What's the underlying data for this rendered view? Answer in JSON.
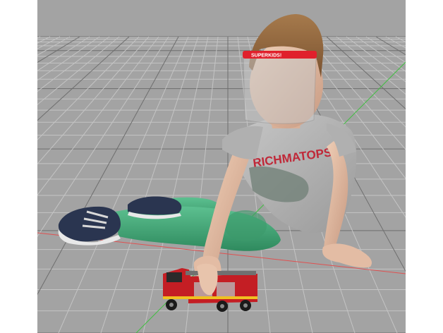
{
  "scene": {
    "background_color": "#a3a3a3",
    "grid_color": "#c4c4c4",
    "grid_major_color": "#6e6e6e",
    "x_axis_color": "#e05050",
    "z_axis_color": "#3fbf3f"
  },
  "face_shield": {
    "band_text": "SUPERKIDS!",
    "band_color": "#e0202c"
  },
  "shirt": {
    "print_text": "RICHMATOPS",
    "print_color": "#c02838",
    "fabric_color": "#b6b6b6"
  },
  "toy": {
    "body_color": "#c41e24",
    "stripe_color": "#f0c020"
  },
  "trousers_color": "#45a878",
  "shoes_color": "#2a3550"
}
